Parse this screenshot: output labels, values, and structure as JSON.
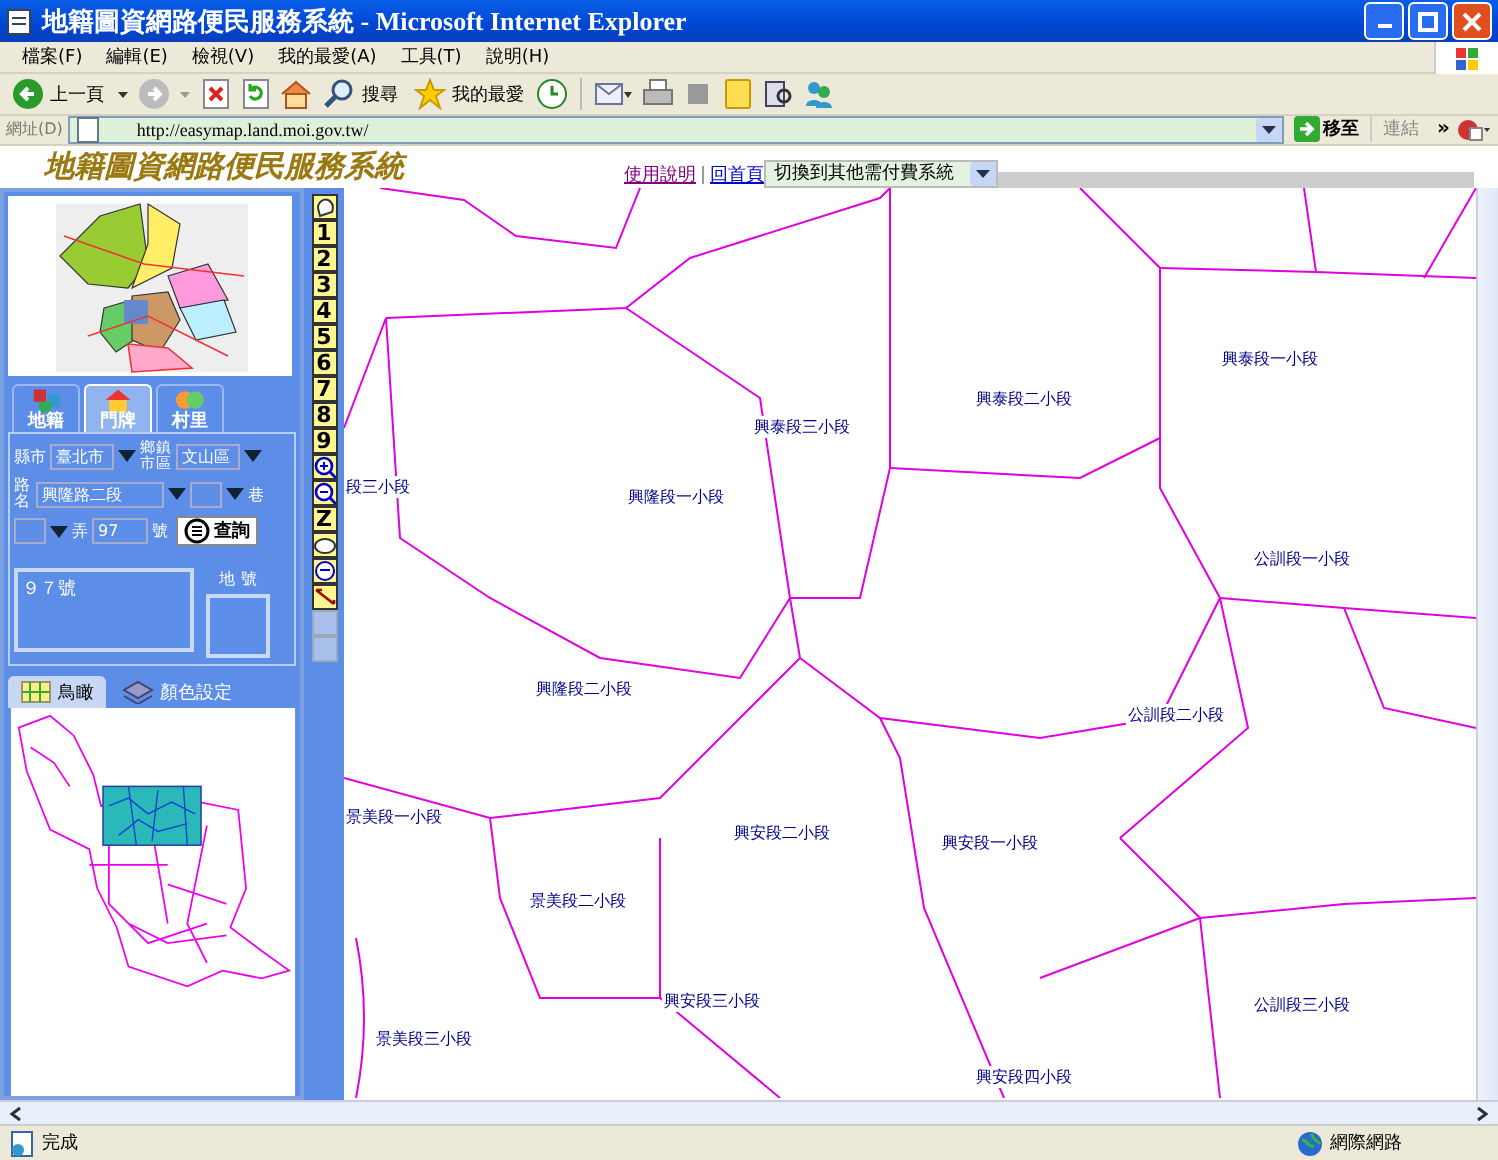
{
  "window": {
    "title": "地籍圖資網路便民服務系統 - Microsoft Internet Explorer"
  },
  "menu": [
    "檔案(F)",
    "編輯(E)",
    "檢視(V)",
    "我的最愛(A)",
    "工具(T)",
    "說明(H)"
  ],
  "toolbar": {
    "back": "上一頁",
    "search": "搜尋",
    "favorites": "我的最愛"
  },
  "address_bar": {
    "label": "網址(D)",
    "url": "http://easymap.land.moi.gov.tw/",
    "go": "移至",
    "links": "連結",
    "more": "»"
  },
  "page_header": {
    "logo": "地籍圖資網路便民服務系統",
    "links": [
      "使用說明",
      "回首頁"
    ],
    "system_select": "切換到其他需付費系統"
  },
  "query_tabs": [
    {
      "label": "地籍",
      "selected": false
    },
    {
      "label": "門牌",
      "selected": true
    },
    {
      "label": "村里",
      "selected": false
    }
  ],
  "search_form": {
    "city_label": "縣市",
    "city": "臺北市",
    "district_label": "鄉鎮市區",
    "district": "文山區",
    "road_label": "路名",
    "road": "興隆路二段",
    "lane_label": "巷",
    "alley_label": "弄",
    "number": "97",
    "number_label": "號",
    "search_button": "查詢"
  },
  "results": {
    "address": "９７號",
    "land_no_label": "地 號"
  },
  "view_tabs": [
    {
      "label": "鳥瞰",
      "selected": true
    },
    {
      "label": "顏色設定",
      "selected": false
    }
  ],
  "map_tools": {
    "levels": [
      "1",
      "2",
      "3",
      "4",
      "5",
      "6",
      "7",
      "8",
      "9"
    ],
    "zoom_z": "Z"
  },
  "map_labels": [
    "段三小段",
    "興泰段三小段",
    "興隆段一小段",
    "興泰段二小段",
    "興泰段一小段",
    "公訓段一小段",
    "興隆段二小段",
    "公訓段二小段",
    "景美段一小段",
    "興安段二小段",
    "興安段一小段",
    "景美段二小段",
    "興安段三小段",
    "公訓段三小段",
    "景美段三小段",
    "興安段四小段"
  ],
  "status_bar": {
    "text": "完成",
    "zone": "網際網路"
  }
}
